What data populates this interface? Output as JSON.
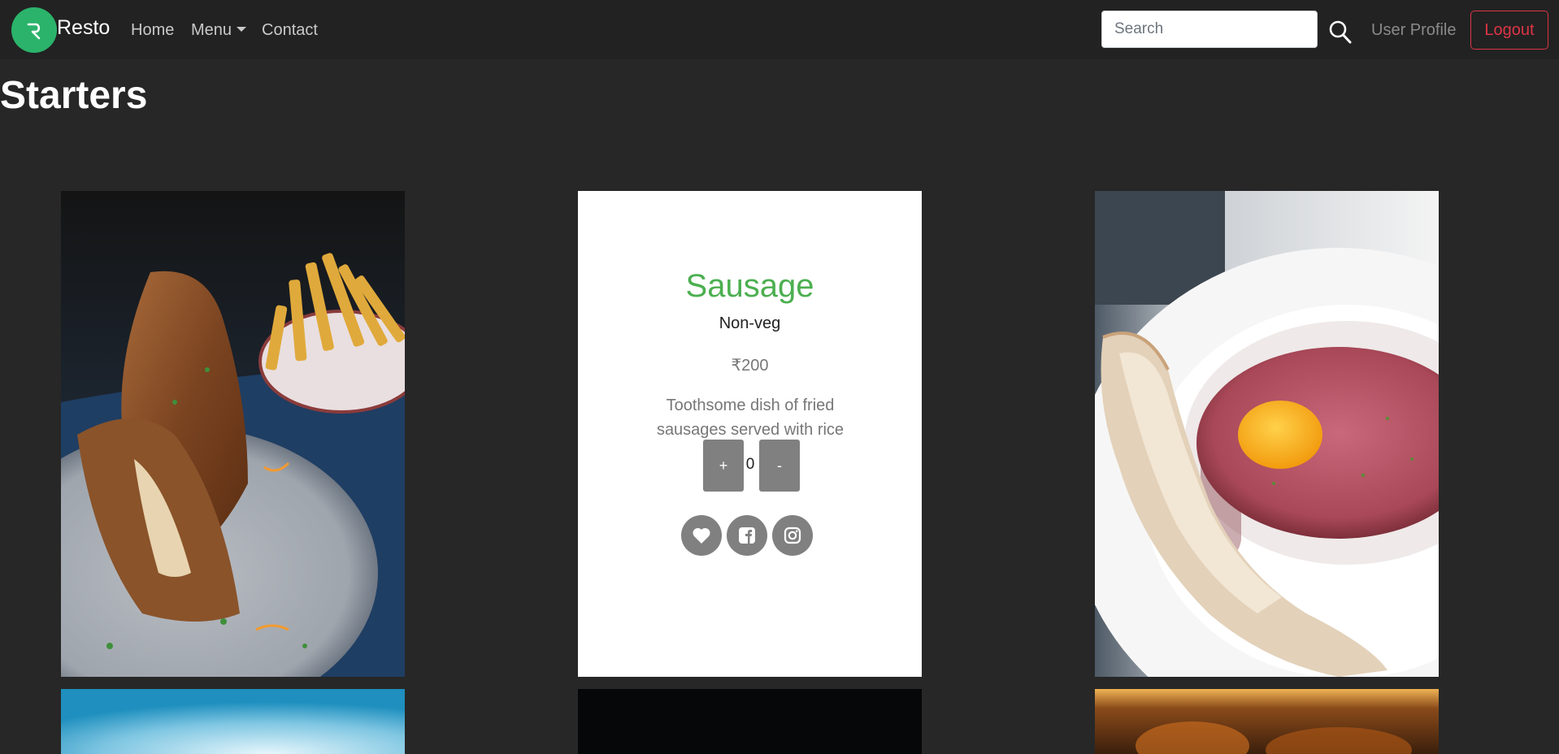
{
  "navbar": {
    "brand": "Resto",
    "links": {
      "home": "Home",
      "menu": "Menu",
      "contact": "Contact"
    },
    "search": {
      "placeholder": "Search",
      "value": ""
    },
    "user_profile": "User Profile",
    "logout": "Logout"
  },
  "page": {
    "title": "Starters"
  },
  "featured_item": {
    "name": "Sausage",
    "type": "Non-veg",
    "price": "₹200",
    "description": "Toothsome dish of fried sausages served with rice",
    "quantity": "0",
    "increment_label": "+",
    "decrement_label": "-"
  },
  "colors": {
    "background": "#272727",
    "navbar": "#222222",
    "brand_logo": "#2bb36b",
    "item_name": "#4caf50",
    "logout": "#dc3545",
    "button_gray": "#808080"
  },
  "icons": [
    "search-icon",
    "heart-icon",
    "facebook-icon",
    "instagram-icon",
    "logo-icon",
    "chevron-down-icon"
  ]
}
